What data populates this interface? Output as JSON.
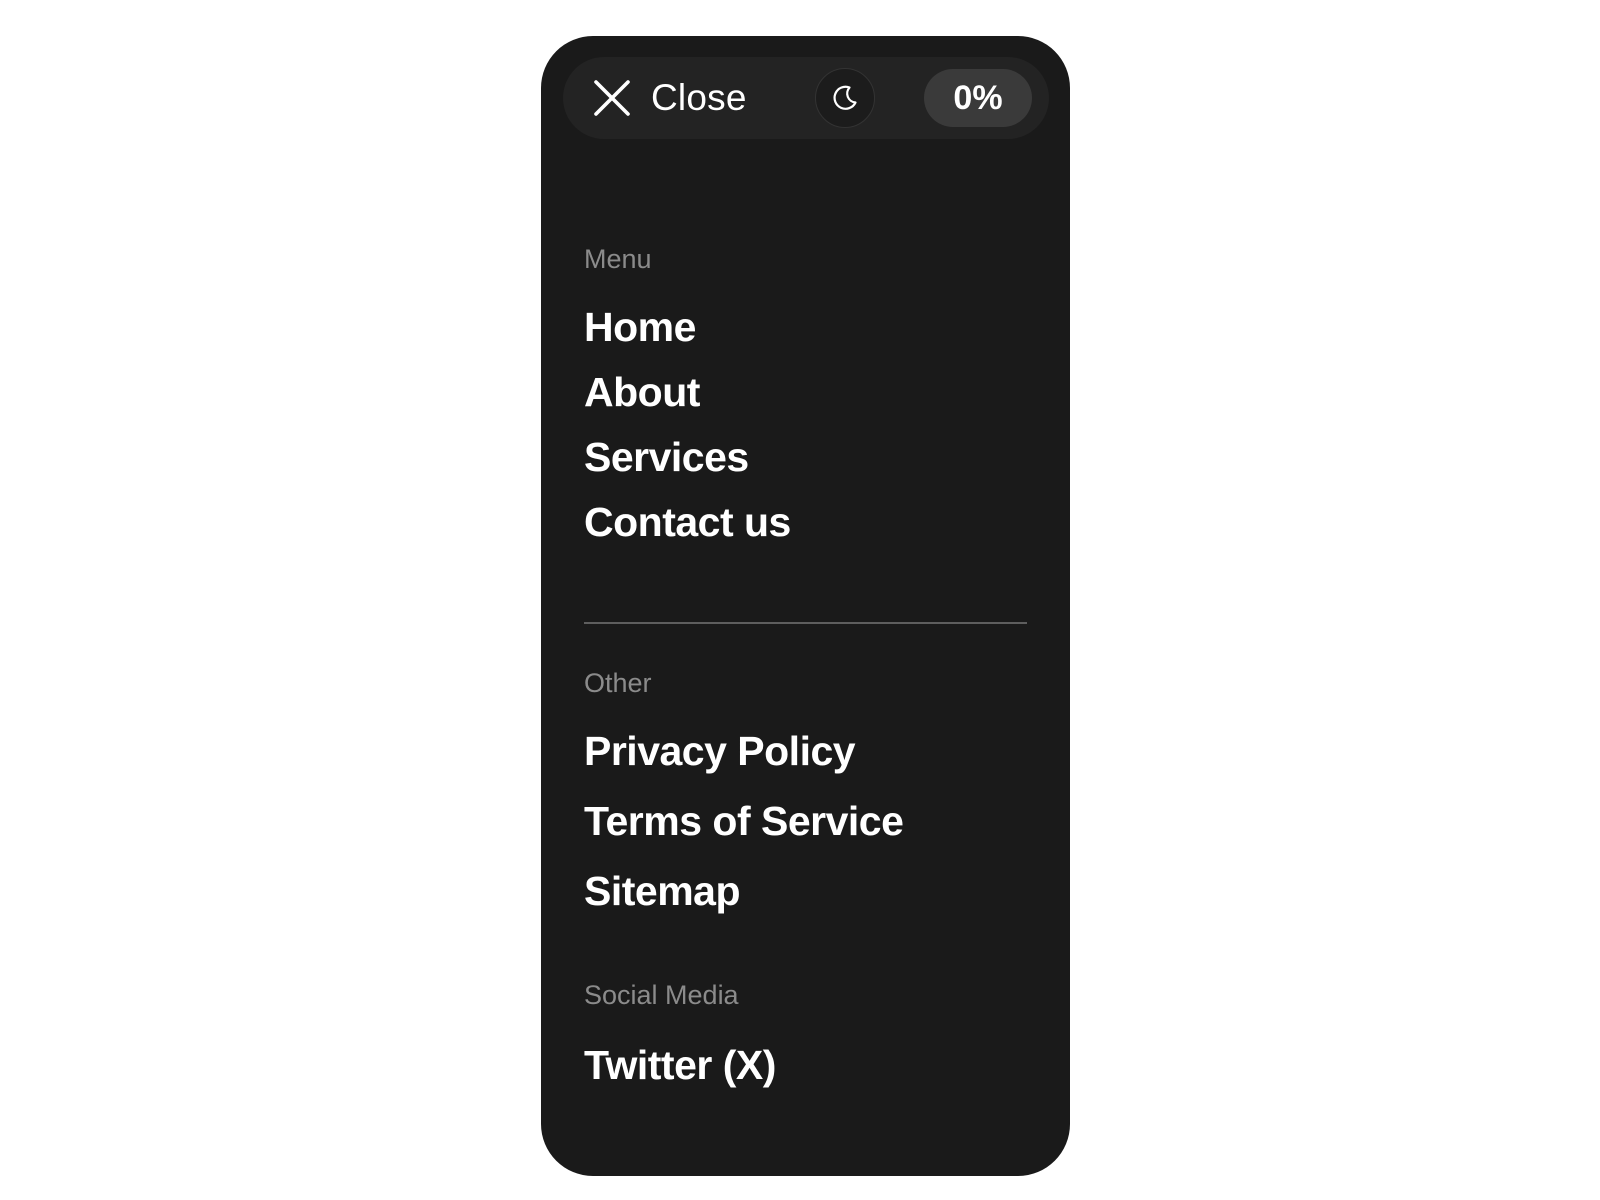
{
  "header": {
    "close_label": "Close",
    "close_icon": "close-icon",
    "theme_icon": "moon-icon",
    "progress": "0%"
  },
  "menu": {
    "title": "Menu",
    "items": [
      "Home",
      "About",
      "Services",
      "Contact us"
    ]
  },
  "other": {
    "title": "Other",
    "items": [
      "Privacy Policy",
      "Terms of Service",
      "Sitemap"
    ]
  },
  "social": {
    "title": "Social Media",
    "items": [
      "Twitter (X)"
    ]
  },
  "colors": {
    "panel": "#1a1a1a",
    "topbar": "#232323",
    "text": "#ffffff",
    "muted": "#8b8b8b",
    "pill": "#3a3a3a"
  }
}
